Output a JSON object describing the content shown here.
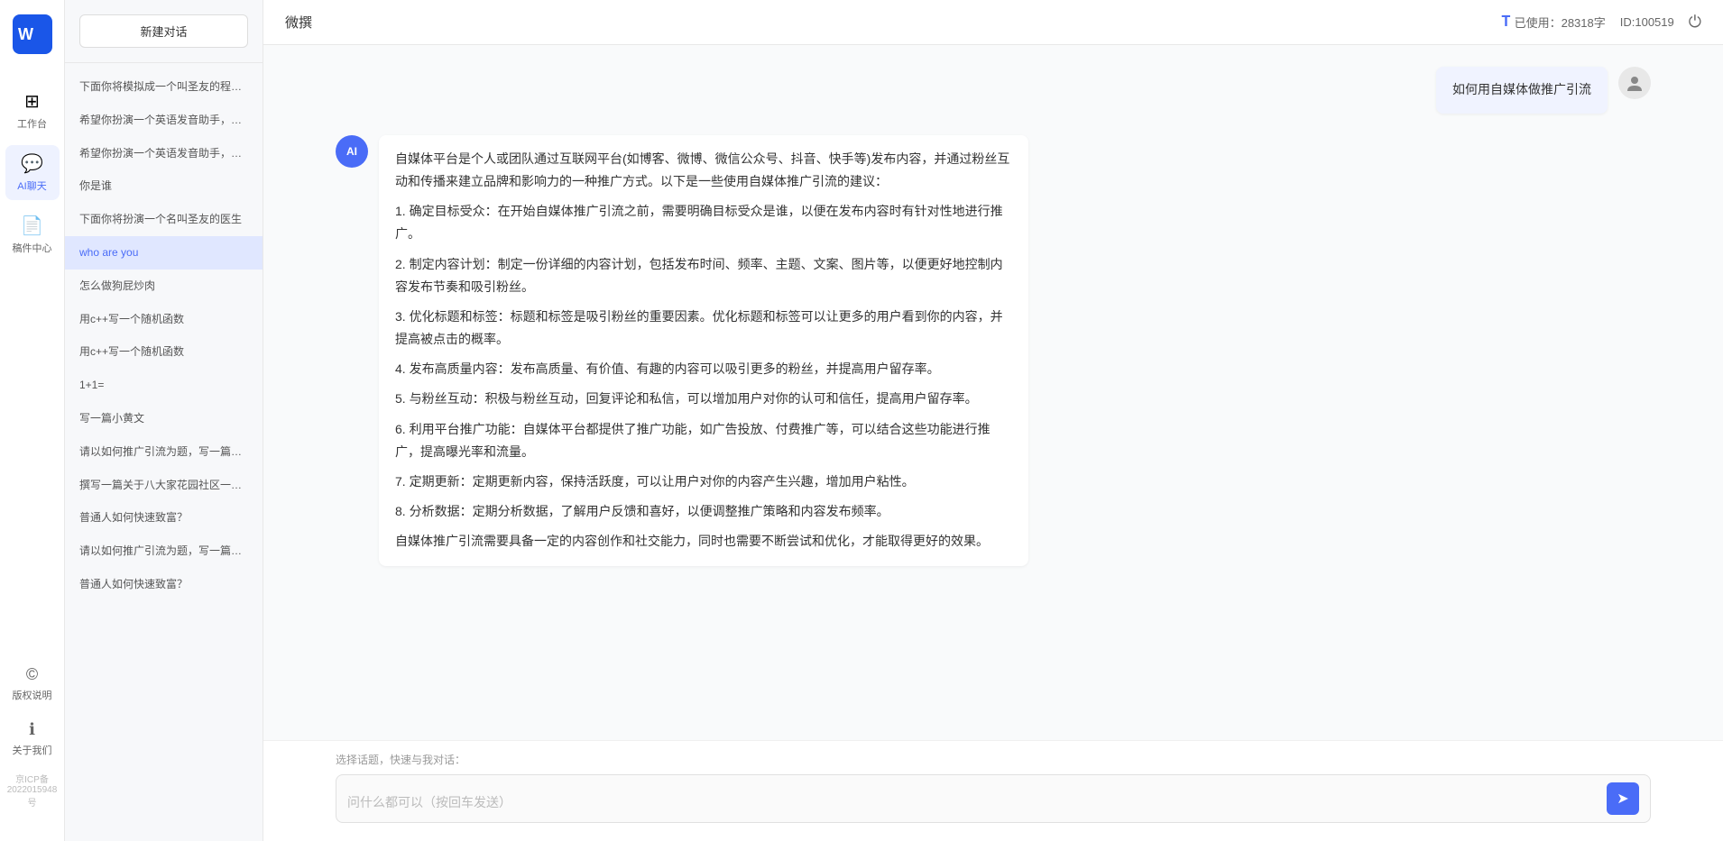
{
  "app": {
    "name": "微撰",
    "logo_text": "W 微撰"
  },
  "header": {
    "title": "微撰",
    "usage_label": "已使用：28318字",
    "user_id_label": "ID:100519",
    "usage_icon": "T"
  },
  "nav": {
    "items": [
      {
        "id": "workbench",
        "label": "工作台",
        "icon": "⊞"
      },
      {
        "id": "ai-chat",
        "label": "AI聊天",
        "icon": "💬",
        "active": true
      },
      {
        "id": "draft",
        "label": "稿件中心",
        "icon": "📄"
      }
    ],
    "bottom_items": [
      {
        "id": "copyright",
        "label": "版权说明",
        "icon": "©"
      },
      {
        "id": "about",
        "label": "关于我们",
        "icon": "ℹ"
      }
    ],
    "icp": "京ICP备2022015948号"
  },
  "sidebar": {
    "new_chat_label": "新建对话",
    "history": [
      {
        "id": 1,
        "text": "下面你将模拟成一个叫圣友的程序员、我说...",
        "active": false
      },
      {
        "id": 2,
        "text": "希望你扮演一个英语发音助手，我提供给你...",
        "active": false
      },
      {
        "id": 3,
        "text": "希望你扮演一个英语发音助手，我提供给你...",
        "active": false
      },
      {
        "id": 4,
        "text": "你是谁",
        "active": false
      },
      {
        "id": 5,
        "text": "下面你将扮演一个名叫圣友的医生",
        "active": false
      },
      {
        "id": 6,
        "text": "who are you",
        "active": true
      },
      {
        "id": 7,
        "text": "怎么做狗屁炒肉",
        "active": false
      },
      {
        "id": 8,
        "text": "用c++写一个随机函数",
        "active": false
      },
      {
        "id": 9,
        "text": "用c++写一个随机函数",
        "active": false
      },
      {
        "id": 10,
        "text": "1+1=",
        "active": false
      },
      {
        "id": 11,
        "text": "写一篇小黄文",
        "active": false
      },
      {
        "id": 12,
        "text": "请以如何推广引流为题，写一篇大纲",
        "active": false
      },
      {
        "id": 13,
        "text": "撰写一篇关于八大家花园社区一刻钟便民生...",
        "active": false
      },
      {
        "id": 14,
        "text": "普通人如何快速致富？",
        "active": false
      },
      {
        "id": 15,
        "text": "请以如何推广引流为题，写一篇大纲",
        "active": false
      },
      {
        "id": 16,
        "text": "普通人如何快速致富？",
        "active": false
      }
    ]
  },
  "chat": {
    "messages": [
      {
        "id": 1,
        "role": "user",
        "avatar_type": "user",
        "text": "如何用自媒体做推广引流"
      },
      {
        "id": 2,
        "role": "ai",
        "avatar_type": "ai",
        "avatar_label": "AI",
        "paragraphs": [
          "自媒体平台是个人或团队通过互联网平台(如博客、微博、微信公众号、抖音、快手等)发布内容，并通过粉丝互动和传播来建立品牌和影响力的一种推广方式。以下是一些使用自媒体推广引流的建议：",
          "1. 确定目标受众：在开始自媒体推广引流之前，需要明确目标受众是谁，以便在发布内容时有针对性地进行推广。",
          "2. 制定内容计划：制定一份详细的内容计划，包括发布时间、频率、主题、文案、图片等，以便更好地控制内容发布节奏和吸引粉丝。",
          "3. 优化标题和标签：标题和标签是吸引粉丝的重要因素。优化标题和标签可以让更多的用户看到你的内容，并提高被点击的概率。",
          "4. 发布高质量内容：发布高质量、有价值、有趣的内容可以吸引更多的粉丝，并提高用户留存率。",
          "5. 与粉丝互动：积极与粉丝互动，回复评论和私信，可以增加用户对你的认可和信任，提高用户留存率。",
          "6. 利用平台推广功能：自媒体平台都提供了推广功能，如广告投放、付费推广等，可以结合这些功能进行推广，提高曝光率和流量。",
          "7. 定期更新：定期更新内容，保持活跃度，可以让用户对你的内容产生兴趣，增加用户粘性。",
          "8. 分析数据：定期分析数据，了解用户反馈和喜好，以便调整推广策略和内容发布频率。",
          "自媒体推广引流需要具备一定的内容创作和社交能力，同时也需要不断尝试和优化，才能取得更好的效果。"
        ]
      }
    ],
    "quick_topics_label": "选择话题，快速与我对话：",
    "input_placeholder": "问什么都可以（按回车发送）"
  }
}
